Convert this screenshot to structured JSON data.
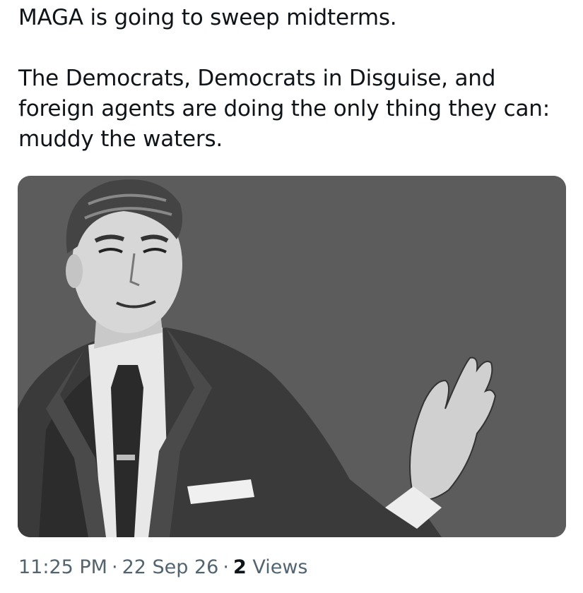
{
  "tweet": {
    "text_line_1": "MAGA is going to sweep midterms.",
    "text_line_2": "The Democrats, Democrats in Disguise, and foreign agents are doing the only thing they can: muddy the waters.",
    "media": {
      "background_color": "#5c5c5c",
      "icon": "halt-gesture-man-illustration"
    },
    "time": "11:25 PM",
    "separator": "·",
    "date": "22 Sep 26",
    "views_count": "2",
    "views_label": "Views"
  },
  "colors": {
    "text": "#0f1419",
    "meta": "#536471"
  }
}
